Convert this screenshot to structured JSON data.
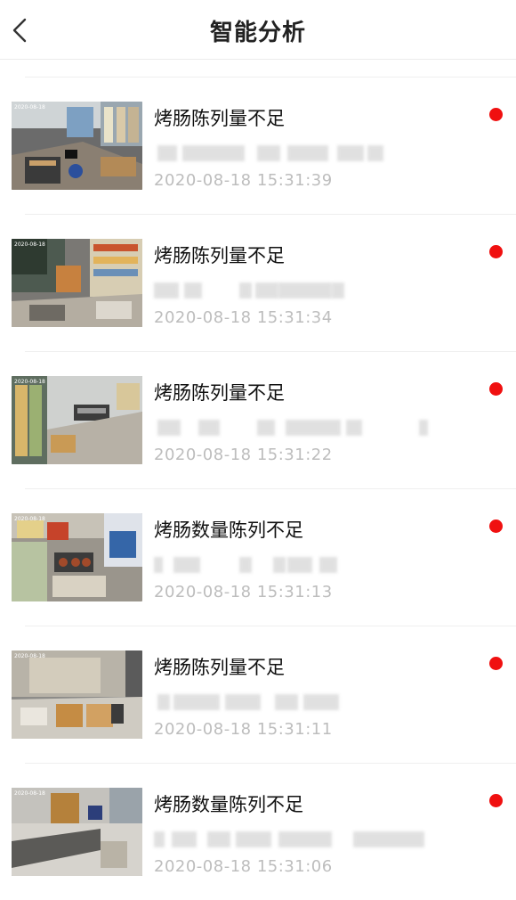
{
  "header": {
    "title": "智能分析"
  },
  "items": [
    {
      "title": "烤肠陈列量不足",
      "time": "2020-08-18 15:31:39"
    },
    {
      "title": "烤肠陈列量不足",
      "time": "2020-08-18 15:31:34"
    },
    {
      "title": "烤肠陈列量不足",
      "time": "2020-08-18 15:31:22"
    },
    {
      "title": "烤肠数量陈列不足",
      "time": "2020-08-18 15:31:13"
    },
    {
      "title": "烤肠陈列量不足",
      "time": "2020-08-18 15:31:11"
    },
    {
      "title": "烤肠数量陈列不足",
      "time": "2020-08-18 15:31:06"
    }
  ],
  "colors": {
    "unread_dot": "#f01010",
    "time_text": "#bdbdbd"
  },
  "icons": {
    "back": "chevron-left-icon",
    "unread": "red-dot-icon"
  }
}
